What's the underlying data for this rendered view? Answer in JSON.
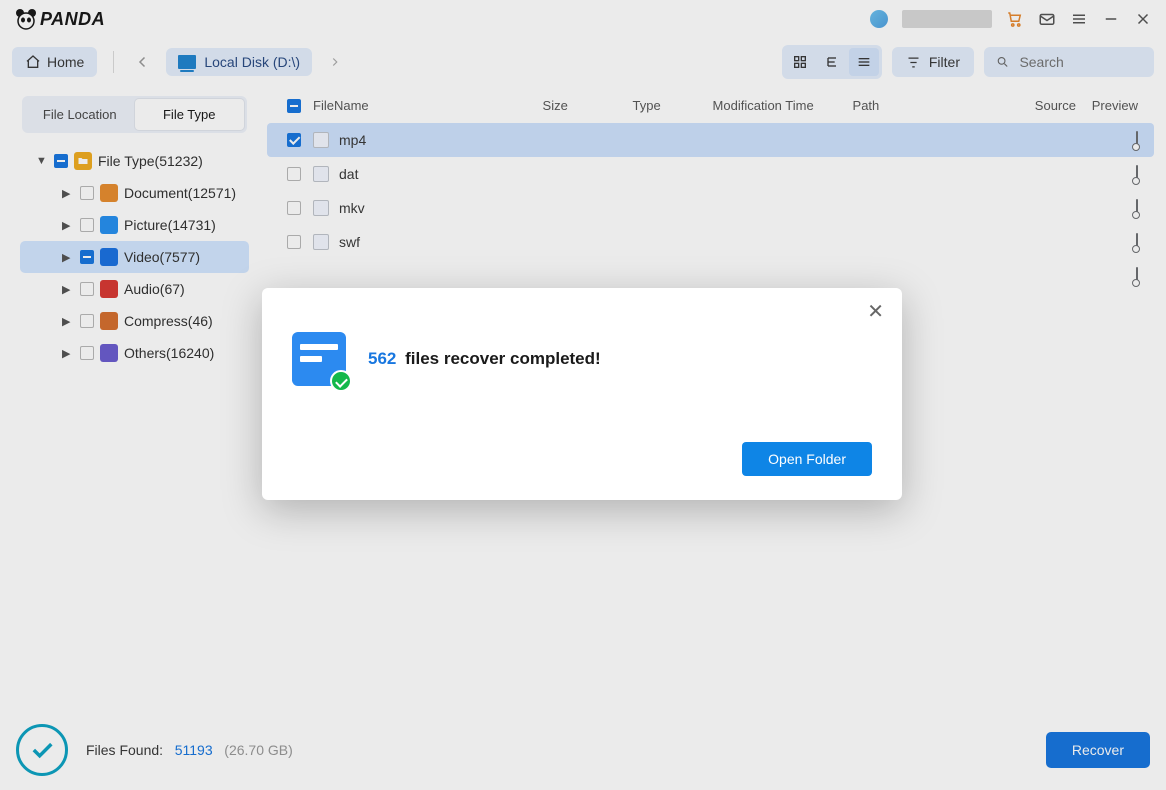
{
  "app": {
    "brand": "PANDA"
  },
  "titlebar": {
    "icons": {
      "cart": "cart-icon",
      "mail": "mail-icon",
      "menu": "menu-icon",
      "minimize": "minimize-icon",
      "close": "close-icon"
    }
  },
  "toolbar": {
    "home": "Home",
    "disk_label": "Local Disk (D:\\)",
    "filter": "Filter",
    "search_placeholder": "Search"
  },
  "sidebar": {
    "tabs": {
      "location": "File Location",
      "type": "File Type"
    },
    "root": {
      "label": "File Type(51232)"
    },
    "items": [
      {
        "label": "Document(12571)",
        "icon": "ico-document"
      },
      {
        "label": "Picture(14731)",
        "icon": "ico-picture"
      },
      {
        "label": "Video(7577)",
        "icon": "ico-video",
        "selected": true
      },
      {
        "label": "Audio(67)",
        "icon": "ico-audio"
      },
      {
        "label": "Compress(46)",
        "icon": "ico-compress"
      },
      {
        "label": "Others(16240)",
        "icon": "ico-others"
      }
    ]
  },
  "table": {
    "headers": {
      "filename": "FileName",
      "size": "Size",
      "type": "Type",
      "modtime": "Modification Time",
      "path": "Path",
      "source": "Source",
      "preview": "Preview"
    },
    "rows": [
      {
        "name": "mp4",
        "checked": true,
        "selected": true
      },
      {
        "name": "dat",
        "checked": false,
        "selected": false
      },
      {
        "name": "mkv",
        "checked": false,
        "selected": false
      },
      {
        "name": "swf",
        "checked": false,
        "selected": false
      }
    ],
    "extra_row": {
      "preview_only": true
    }
  },
  "footer": {
    "label": "Files Found:",
    "count": "51193",
    "size": "(26.70 GB)",
    "recover": "Recover"
  },
  "modal": {
    "count": "562",
    "message": "files recover completed!",
    "button": "Open Folder"
  }
}
